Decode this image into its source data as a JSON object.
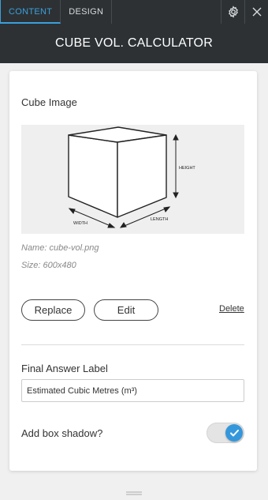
{
  "tabs": [
    {
      "label": "CONTENT",
      "active": true
    },
    {
      "label": "DESIGN",
      "active": false
    }
  ],
  "toolbar_icons": [
    "gear-icon",
    "close-icon"
  ],
  "header": {
    "title": "CUBE VOL. CALCULATOR"
  },
  "image_section": {
    "label": "Cube Image",
    "diagram_labels": {
      "height": "HEIGHT",
      "width": "WIDTH",
      "length": "LENGTH"
    },
    "name": "Name: cube-vol.png",
    "size": "Size: 600x480"
  },
  "actions": {
    "replace": "Replace",
    "edit": "Edit",
    "delete": "Delete"
  },
  "final_answer": {
    "label": "Final Answer Label",
    "value": "Estimated Cubic Metres (m³)"
  },
  "box_shadow": {
    "label": "Add box shadow?",
    "enabled": true
  },
  "colors": {
    "accent": "#3597db",
    "dark_bar": "#2d3134",
    "panel_bg": "#f0f0f0"
  }
}
